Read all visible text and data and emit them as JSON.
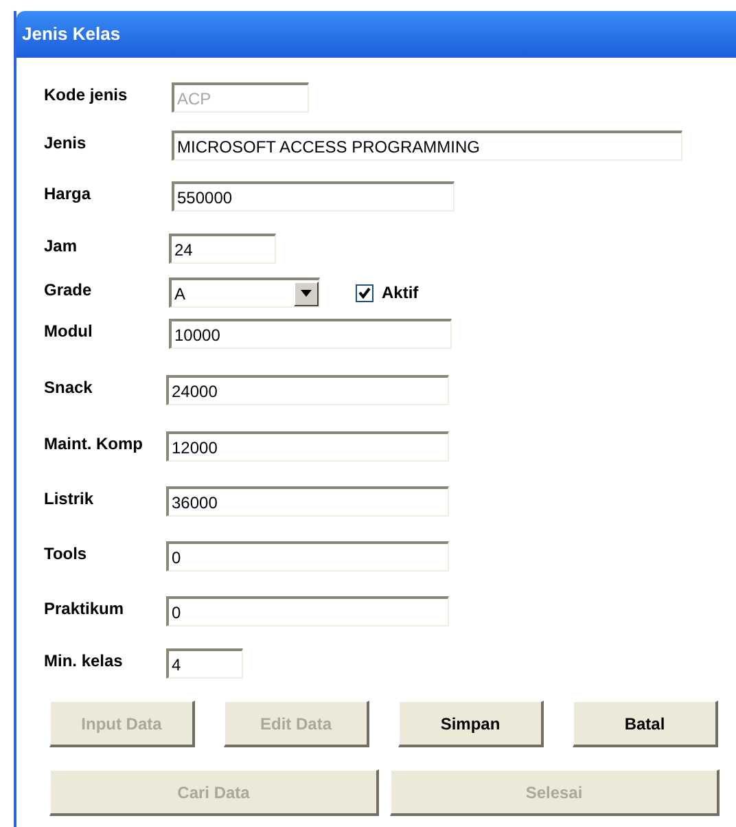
{
  "window": {
    "title": "Jenis Kelas"
  },
  "fields": [
    {
      "kind": "text",
      "label": "Kode jenis",
      "value": "ACP",
      "disabled": true
    },
    {
      "kind": "text",
      "label": "Jenis",
      "value": "MICROSOFT ACCESS PROGRAMMING",
      "disabled": false
    },
    {
      "kind": "text",
      "label": "Harga",
      "value": "550000",
      "disabled": false
    },
    {
      "kind": "text",
      "label": "Jam",
      "value": "24",
      "disabled": false
    },
    {
      "kind": "combo",
      "label": "Grade",
      "value": "A",
      "disabled": false,
      "checkbox": {
        "label": "Aktif",
        "checked": true
      }
    },
    {
      "kind": "text",
      "label": "Modul",
      "value": "10000",
      "disabled": false
    },
    {
      "kind": "text",
      "label": "Snack",
      "value": "24000",
      "disabled": false
    },
    {
      "kind": "text",
      "label": "Maint. Komp",
      "value": "12000",
      "disabled": false
    },
    {
      "kind": "text",
      "label": "Listrik",
      "value": "36000",
      "disabled": false
    },
    {
      "kind": "text",
      "label": "Tools",
      "value": "0",
      "disabled": false
    },
    {
      "kind": "text",
      "label": "Praktikum",
      "value": "0",
      "disabled": false
    },
    {
      "kind": "text",
      "label": "Min. kelas",
      "value": "4",
      "disabled": false
    }
  ],
  "buttons": [
    {
      "label": "Input Data",
      "disabled": true
    },
    {
      "label": "Edit Data",
      "disabled": true
    },
    {
      "label": "Simpan",
      "disabled": false
    },
    {
      "label": "Batal",
      "disabled": false
    }
  ],
  "wide_buttons": [
    {
      "label": "Cari Data",
      "disabled": true
    },
    {
      "label": "Selesai",
      "disabled": true
    }
  ]
}
